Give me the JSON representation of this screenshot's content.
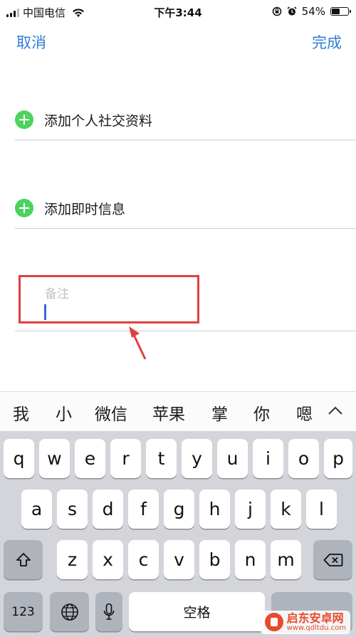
{
  "status_bar": {
    "carrier": "中国电信",
    "time": "下午3:44",
    "battery_percent": "54%",
    "battery_level": 0.54
  },
  "nav": {
    "cancel_label": "取消",
    "done_label": "完成"
  },
  "rows": {
    "add_social_profile": "添加个人社交资料",
    "add_instant_message": "添加即时信息"
  },
  "notes": {
    "placeholder": "备注"
  },
  "annotation": {
    "highlight_color": "#e04040"
  },
  "candidates": [
    "我",
    "小",
    "微信",
    "苹果",
    "掌",
    "你",
    "嗯"
  ],
  "keyboard": {
    "row1": [
      "q",
      "w",
      "e",
      "r",
      "t",
      "y",
      "u",
      "i",
      "o",
      "p"
    ],
    "row2": [
      "a",
      "s",
      "d",
      "f",
      "g",
      "h",
      "j",
      "k",
      "l"
    ],
    "row3": [
      "z",
      "x",
      "c",
      "v",
      "b",
      "n",
      "m"
    ],
    "numbers_label": "123",
    "space_label": "空格"
  },
  "watermark": {
    "title": "启东安卓网",
    "url": "www.qdltdu.com"
  }
}
